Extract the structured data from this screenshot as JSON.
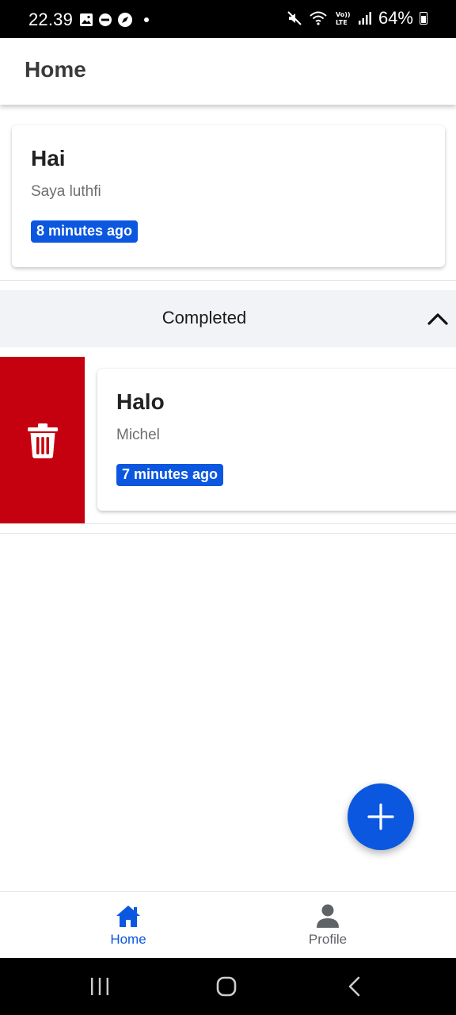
{
  "status_bar": {
    "time": "22.39",
    "battery": "64%",
    "left_icons": [
      "gallery-icon",
      "dnd-icon",
      "compass-icon",
      "notification-dot-icon"
    ],
    "right_icons": [
      "mute-icon",
      "wifi-icon",
      "volte-icon",
      "signal-icon",
      "battery-icon"
    ],
    "volte_text": "Vo)) LTE"
  },
  "app_bar": {
    "title": "Home"
  },
  "tasks": [
    {
      "title": "Hai",
      "subtitle": "Saya luthfi",
      "time": "8 minutes ago"
    }
  ],
  "completed_section": {
    "title": "Completed",
    "expanded": true,
    "items": [
      {
        "title": "Halo",
        "subtitle": "Michel",
        "time": "7 minutes ago",
        "swipe_action": "delete"
      }
    ]
  },
  "fab": {
    "icon": "plus-icon"
  },
  "bottom_nav": {
    "items": [
      {
        "label": "Home",
        "icon": "home-icon",
        "active": true
      },
      {
        "label": "Profile",
        "icon": "person-icon",
        "active": false
      }
    ]
  },
  "system_nav": {
    "buttons": [
      "recents-icon",
      "home-circle-icon",
      "back-icon"
    ]
  },
  "colors": {
    "accent": "#0b57e0",
    "delete": "#c5000f",
    "section_bg": "#f2f3f6",
    "nav_inactive": "#5f6368"
  }
}
